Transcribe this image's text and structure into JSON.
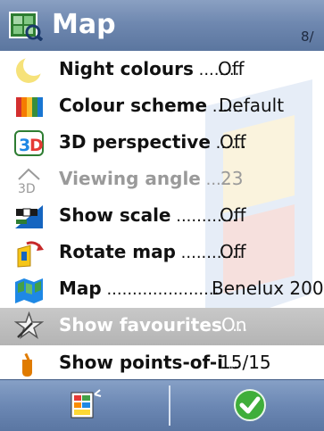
{
  "header": {
    "title": "Map",
    "page_indicator": "8/"
  },
  "menu": {
    "items": [
      {
        "label": "Night colours",
        "dots": " ........",
        "value": "Off",
        "icon": "moon-icon",
        "state": "normal"
      },
      {
        "label": "Colour scheme",
        "dots": " ......",
        "value": "Default",
        "icon": "palette-icon",
        "state": "normal"
      },
      {
        "label": "3D perspective",
        "dots": " ......",
        "value": "Off",
        "icon": "3d-icon",
        "state": "normal"
      },
      {
        "label": "Viewing angle",
        "dots": " .....",
        "value": "23",
        "icon": "viewing-angle-icon",
        "state": "disabled"
      },
      {
        "label": "Show scale",
        "dots": " ............",
        "value": "Off",
        "icon": "scale-icon",
        "state": "normal"
      },
      {
        "label": "Rotate map",
        "dots": " ............",
        "value": "Off",
        "icon": "rotate-map-icon",
        "state": "normal"
      },
      {
        "label": "Map",
        "dots": " ......................",
        "value": "Benelux 200..",
        "icon": "map-icon",
        "state": "normal"
      },
      {
        "label": "Show favourites",
        "dots": " ....",
        "value": "On",
        "icon": "star-icon",
        "state": "selected"
      },
      {
        "label": "Show points-of-i",
        "dots": "...",
        "value": "15/15",
        "icon": "poi-icon",
        "state": "normal"
      }
    ]
  },
  "footer": {
    "left_icon": "options-menu-icon",
    "right_icon": "confirm-check-icon"
  }
}
